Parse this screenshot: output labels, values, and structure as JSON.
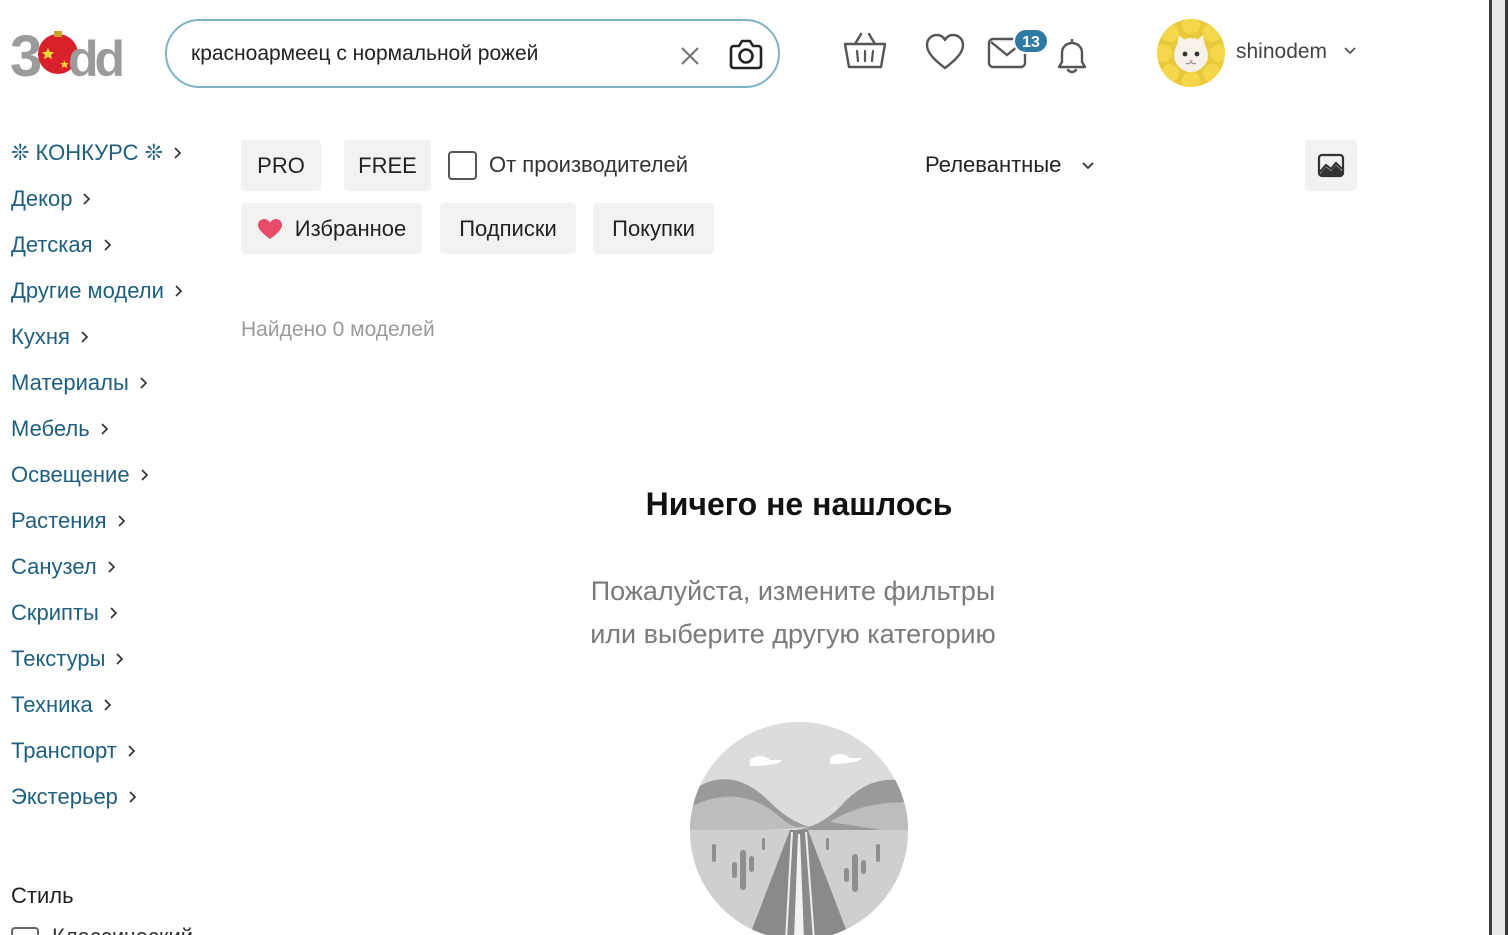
{
  "header": {
    "logo_text": "3ddd",
    "search": {
      "value": "красноармеец с нормальной рожей",
      "placeholder": ""
    },
    "mail_badge": "13",
    "username": "shinodem"
  },
  "sidebar": {
    "categories": [
      {
        "label": "❊ КОНКУРС ❊"
      },
      {
        "label": "Декор"
      },
      {
        "label": "Детская"
      },
      {
        "label": "Другие модели"
      },
      {
        "label": "Кухня"
      },
      {
        "label": "Материалы"
      },
      {
        "label": "Мебель"
      },
      {
        "label": "Освещение"
      },
      {
        "label": "Растения"
      },
      {
        "label": "Санузел"
      },
      {
        "label": "Скрипты"
      },
      {
        "label": "Текстуры"
      },
      {
        "label": "Техника"
      },
      {
        "label": "Транспорт"
      },
      {
        "label": "Экстерьер"
      }
    ],
    "style_title": "Стиль",
    "style_first_item": "Классический"
  },
  "filters": {
    "pro": "PRO",
    "free": "FREE",
    "manufacturers": "От производителей",
    "sort": "Релевантные",
    "favorites": "Избранное",
    "subscriptions": "Подписки",
    "purchases": "Покупки"
  },
  "results": {
    "found": "Найдено 0 моделей"
  },
  "empty_state": {
    "title": "Ничего не нашлось",
    "line1": "Пожалуйста, измените фильтры",
    "line2": "или выберите другую категорию"
  },
  "colors": {
    "accent_link": "#1e5f80",
    "search_border": "#7fb3c9",
    "badge": "#2e7aa5",
    "heart": "#e84a6a"
  }
}
